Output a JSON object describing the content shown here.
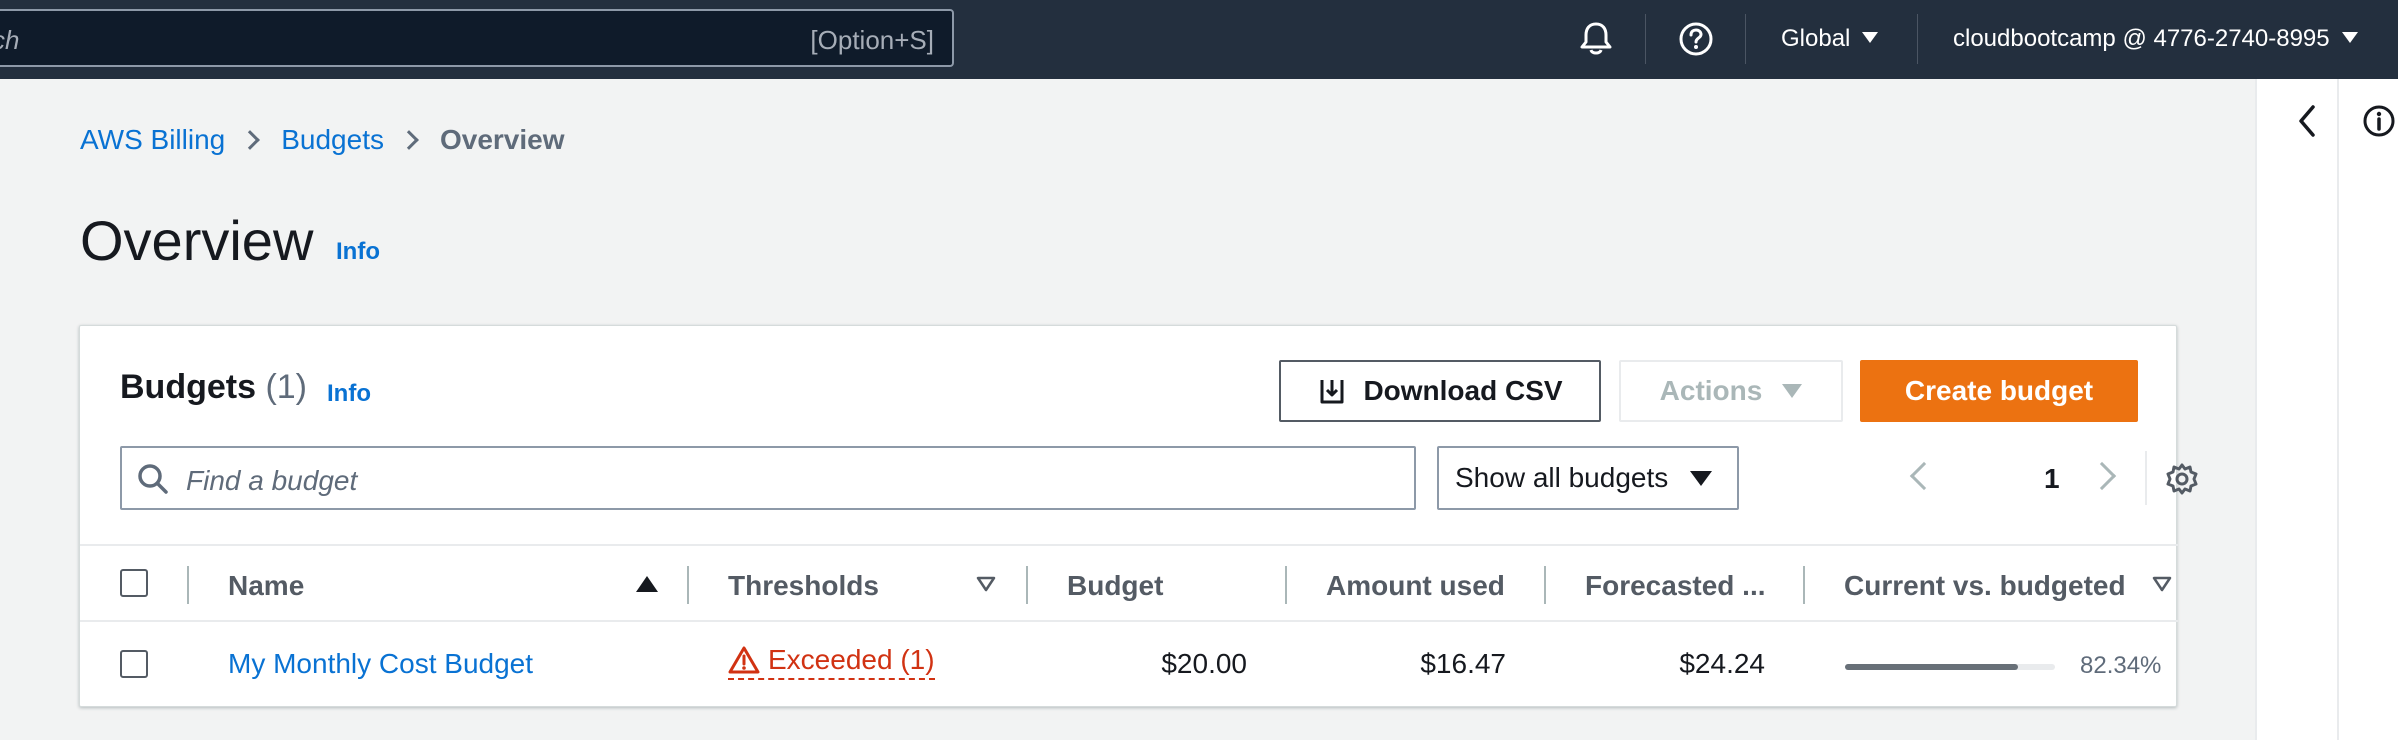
{
  "topnav": {
    "search_placeholder": "ch",
    "search_shortcut": "[Option+S]",
    "region": "Global",
    "account": "cloudbootcamp @ 4776-2740-8995"
  },
  "breadcrumb": {
    "items": [
      "AWS Billing",
      "Budgets"
    ],
    "current": "Overview"
  },
  "page": {
    "title": "Overview",
    "info": "Info"
  },
  "budgets_panel": {
    "title": "Budgets",
    "count": "(1)",
    "info": "Info",
    "download_label": "Download CSV",
    "actions_label": "Actions",
    "create_label": "Create budget",
    "filter_placeholder": "Find a budget",
    "filter_select": "Show all budgets",
    "page_number": "1"
  },
  "table": {
    "headers": {
      "name": "Name",
      "thresholds": "Thresholds",
      "budget": "Budget",
      "amount_used": "Amount used",
      "forecasted": "Forecasted ...",
      "current_vs_budgeted": "Current vs. budgeted"
    },
    "rows": [
      {
        "name": "My Monthly Cost Budget",
        "thresholds": "Exceeded (1)",
        "budget": "$20.00",
        "amount_used": "$16.47",
        "forecasted": "$24.24",
        "current_vs_budgeted": "82.34%",
        "progress": 0.8234
      }
    ]
  },
  "colors": {
    "nav_bg": "#232f3e",
    "link": "#0972d3",
    "primary_button": "#ec7211",
    "error": "#d13212"
  }
}
